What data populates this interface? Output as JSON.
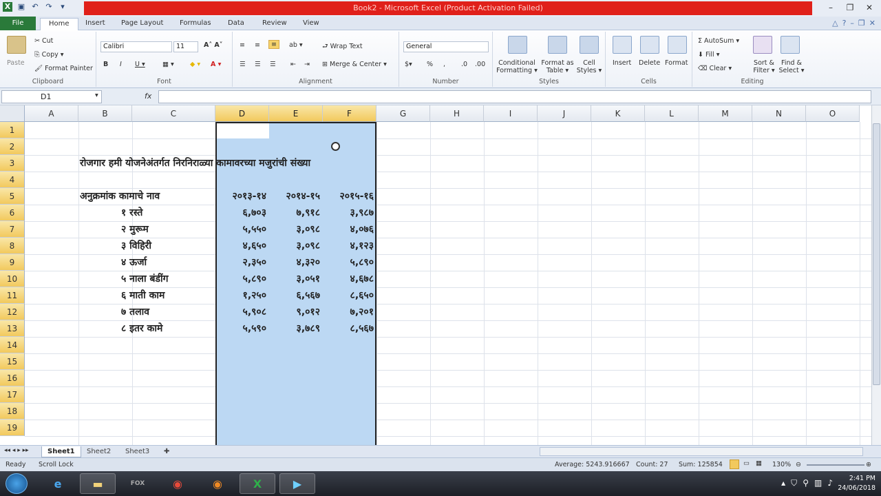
{
  "window": {
    "title": "Book2 - Microsoft Excel (Product Activation Failed)"
  },
  "ribbon_tabs": [
    "File",
    "Home",
    "Insert",
    "Page Layout",
    "Formulas",
    "Data",
    "Review",
    "View"
  ],
  "ribbon": {
    "clipboard": {
      "label": "Clipboard",
      "paste": "Paste",
      "cut": "Cut",
      "copy": "Copy ▾",
      "format_painter": "Format Painter"
    },
    "font": {
      "label": "Font",
      "name": "Calibri",
      "size": "11"
    },
    "alignment": {
      "label": "Alignment",
      "wrap": "Wrap Text",
      "merge": "Merge & Center ▾"
    },
    "number": {
      "label": "Number",
      "format": "General"
    },
    "styles": {
      "label": "Styles",
      "conditional": "Conditional Formatting ▾",
      "format_table": "Format as Table ▾",
      "cell_styles": "Cell Styles ▾"
    },
    "cells": {
      "label": "Cells",
      "insert": "Insert",
      "delete": "Delete",
      "format": "Format"
    },
    "editing": {
      "label": "Editing",
      "autosum": "AutoSum ▾",
      "fill": "Fill ▾",
      "clear": "Clear ▾",
      "sort": "Sort & Filter ▾",
      "find": "Find & Select ▾"
    }
  },
  "formula_bar": {
    "name_box": "D1",
    "fx": "fx",
    "value": ""
  },
  "columns": [
    "A",
    "B",
    "C",
    "D",
    "E",
    "F",
    "G",
    "H",
    "I",
    "J",
    "K",
    "L",
    "M",
    "N",
    "O"
  ],
  "rows": [
    "1",
    "2",
    "3",
    "4",
    "5",
    "6",
    "7",
    "8",
    "9",
    "10",
    "11",
    "12",
    "13",
    "14",
    "15",
    "16",
    "17",
    "18",
    "19"
  ],
  "sheet": {
    "title": "रोजगार हमी योजनेअंतर्गत निरनिराळ्या कामावरच्या मजुरांची संख्या",
    "header": {
      "label": "अनुक्रमांक कामाचे नाव",
      "y1": "२०१३-१४",
      "y2": "२०१४-१५",
      "y3": "२०१५-१६"
    },
    "data": [
      {
        "name": "१ रस्ते",
        "d": "६,७०३",
        "e": "७,९१८",
        "f": "३,९८७"
      },
      {
        "name": "२ मुरूम",
        "d": "५,५५०",
        "e": "३,०९८",
        "f": "४,०७६"
      },
      {
        "name": "३ विहिरी",
        "d": "४,६५०",
        "e": "३,०९८",
        "f": "४,१२३"
      },
      {
        "name": "४ ऊर्जा",
        "d": "२,३५०",
        "e": "४,३२०",
        "f": "५,८९०"
      },
      {
        "name": "५ नाला बंडींग",
        "d": "५,८९०",
        "e": "३,०५१",
        "f": "४,६७८"
      },
      {
        "name": "६ माती काम",
        "d": "१,२५०",
        "e": "६,५६७",
        "f": "८,६५०"
      },
      {
        "name": "७ तलाव",
        "d": "५,९०८",
        "e": "९,०१२",
        "f": "७,२०१"
      },
      {
        "name": "८ इतर कामे",
        "d": "५,५९०",
        "e": "३,७८९",
        "f": "८,५६७"
      }
    ]
  },
  "sheet_tabs": [
    "Sheet1",
    "Sheet2",
    "Sheet3"
  ],
  "status": {
    "mode": "Ready",
    "scroll_lock": "Scroll Lock",
    "average": "Average: 5243.916667",
    "count": "Count: 27",
    "sum": "Sum: 125854",
    "zoom": "130%"
  },
  "taskbar": {
    "time": "2:41 PM",
    "date": "24/06/2018",
    "apps": [
      "ie-icon",
      "folder-icon",
      "fox-icon",
      "chrome-icon",
      "firefox-icon",
      "excel-icon",
      "media-icon"
    ]
  },
  "colors": {
    "selection": "#bcd8f3",
    "title_red": "#e0201a",
    "header_selected": "#f2c95d",
    "file_tab": "#2a7a3a"
  }
}
